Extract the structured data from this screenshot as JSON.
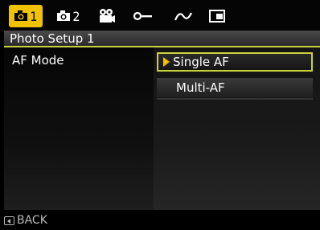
{
  "tabs": [
    {
      "icon": "camera-icon",
      "number": "1",
      "active": true
    },
    {
      "icon": "camera-icon",
      "number": "2",
      "active": false
    },
    {
      "icon": "movie-camera-icon",
      "number": "",
      "active": false
    },
    {
      "icon": "wrench-icon",
      "number": "",
      "active": false
    },
    {
      "icon": "wave-icon",
      "number": "",
      "active": false
    },
    {
      "icon": "battery-card-icon",
      "number": "",
      "active": false
    }
  ],
  "header": {
    "title": "Photo Setup 1"
  },
  "setting": {
    "label": "AF Mode"
  },
  "options": [
    {
      "label": "Single AF",
      "selected": true
    },
    {
      "label": "Multi-AF",
      "selected": false
    }
  ],
  "footer": {
    "back_label": "BACK"
  },
  "colors": {
    "accent": "#f1c200",
    "highlight_border": "#c9d23a"
  }
}
